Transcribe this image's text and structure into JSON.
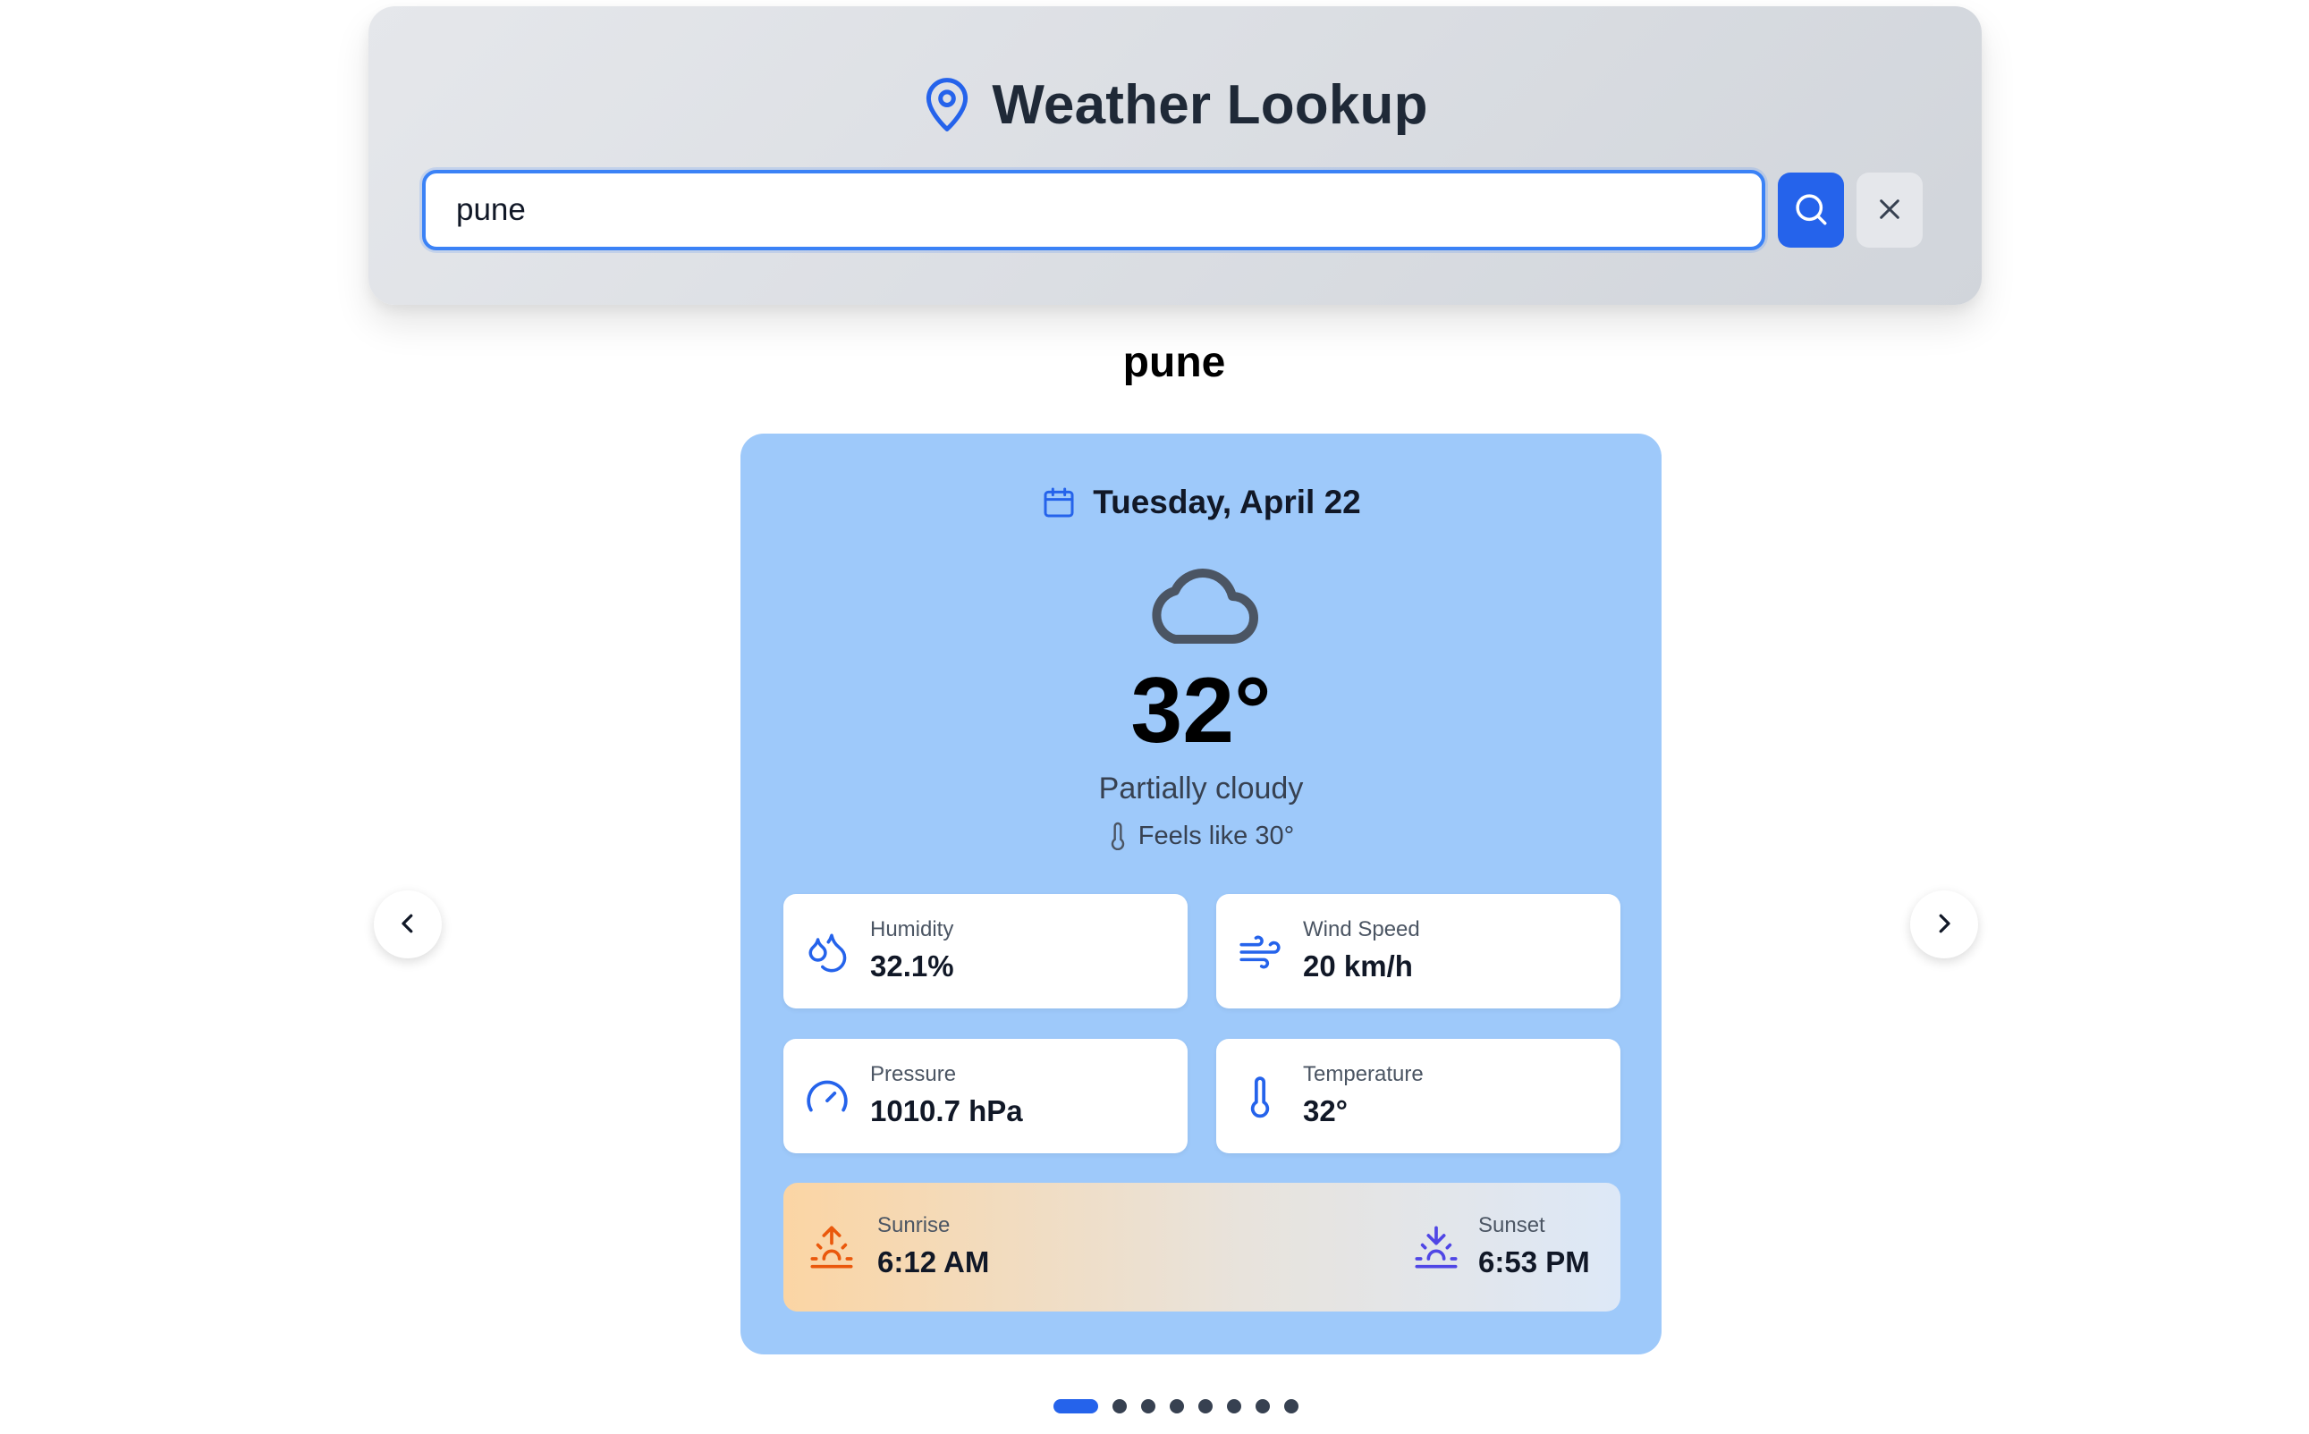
{
  "header": {
    "title": "Weather Lookup",
    "icon": "map-pin-icon",
    "accent_color": "#2563eb"
  },
  "search": {
    "value": "pune",
    "search_icon": "search-icon",
    "clear_icon": "close-icon"
  },
  "city": {
    "name": "pune"
  },
  "card": {
    "date": "Tuesday, April 22",
    "weather_icon": "cloud-icon",
    "temperature": "32°",
    "condition": "Partially cloudy",
    "feels_like": "Feels like 30°",
    "background_color": "#9ec9fa",
    "stats": {
      "humidity": {
        "label": "Humidity",
        "value": "32.1%",
        "icon": "droplets-icon"
      },
      "wind": {
        "label": "Wind Speed",
        "value": "20 km/h",
        "icon": "wind-icon"
      },
      "pressure": {
        "label": "Pressure",
        "value": "1010.7 hPa",
        "icon": "gauge-icon"
      },
      "temperature": {
        "label": "Temperature",
        "value": "32°",
        "icon": "thermometer-icon"
      }
    },
    "sunrise": {
      "label": "Sunrise",
      "value": "6:12 AM",
      "icon": "sunrise-icon"
    },
    "sunset": {
      "label": "Sunset",
      "value": "6:53 PM",
      "icon": "sunset-icon"
    }
  },
  "carousel": {
    "prev_icon": "chevron-left-icon",
    "next_icon": "chevron-right-icon",
    "total_slides": 8,
    "active_slide": 1
  }
}
